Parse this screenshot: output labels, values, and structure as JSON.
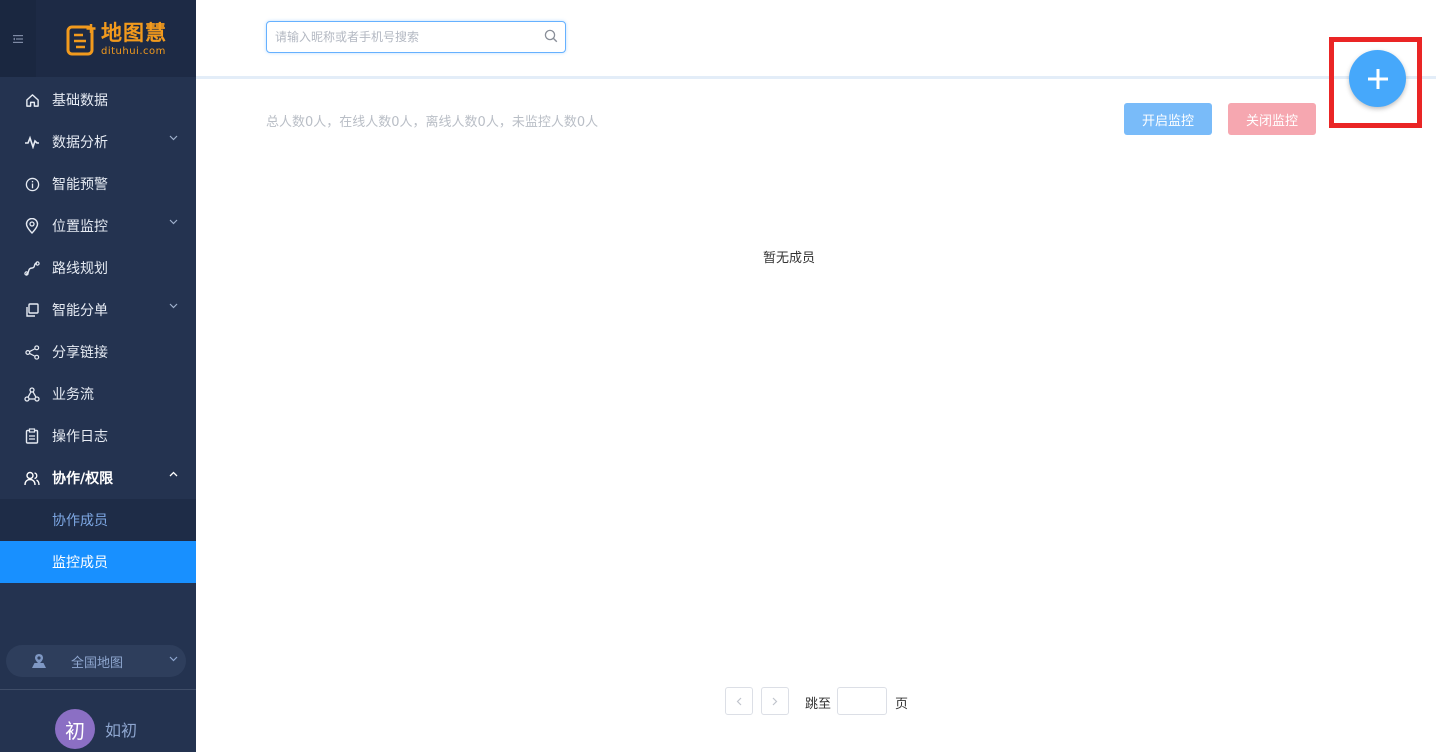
{
  "brand": {
    "name_cn": "地图慧",
    "name_en": "dituhui.com",
    "color": "#f29a1d"
  },
  "sidebar": {
    "items": [
      {
        "label": "基础数据",
        "icon": "home-icon",
        "has_children": false
      },
      {
        "label": "数据分析",
        "icon": "pulse-icon",
        "has_children": true
      },
      {
        "label": "智能预警",
        "icon": "info-circle-icon",
        "has_children": false
      },
      {
        "label": "位置监控",
        "icon": "location-pin-icon",
        "has_children": true
      },
      {
        "label": "路线规划",
        "icon": "route-icon",
        "has_children": false
      },
      {
        "label": "智能分单",
        "icon": "copy-icon",
        "has_children": true
      },
      {
        "label": "分享链接",
        "icon": "share-icon",
        "has_children": false
      },
      {
        "label": "业务流",
        "icon": "workflow-icon",
        "has_children": false
      },
      {
        "label": "操作日志",
        "icon": "clipboard-icon",
        "has_children": false
      },
      {
        "label": "协作/权限",
        "icon": "users-icon",
        "has_children": true,
        "expanded": true
      }
    ],
    "sub_items": [
      {
        "label": "协作成员",
        "active": false
      },
      {
        "label": "监控成员",
        "active": true
      }
    ],
    "map_select": {
      "label": "全国地图",
      "icon": "map-user-icon"
    },
    "user": {
      "avatar_char": "初",
      "name": "如初",
      "avatar_color": "#8b6fc4"
    }
  },
  "search": {
    "placeholder": "请输入昵称或者手机号搜索",
    "value": ""
  },
  "stats_text": "总人数0人，在线人数0人，离线人数0人，未监控人数0人",
  "buttons": {
    "start_monitor": "开启监控",
    "stop_monitor": "关闭监控"
  },
  "empty_text": "暂无成员",
  "pagination": {
    "prev": "‹",
    "next": "›",
    "jump_label": "跳至",
    "page_label": "页",
    "jump_value": ""
  },
  "colors": {
    "sidebar_bg": "#243350",
    "active_item": "#1890ff",
    "fab": "#46a8fb",
    "highlight_box": "#ea2525"
  }
}
